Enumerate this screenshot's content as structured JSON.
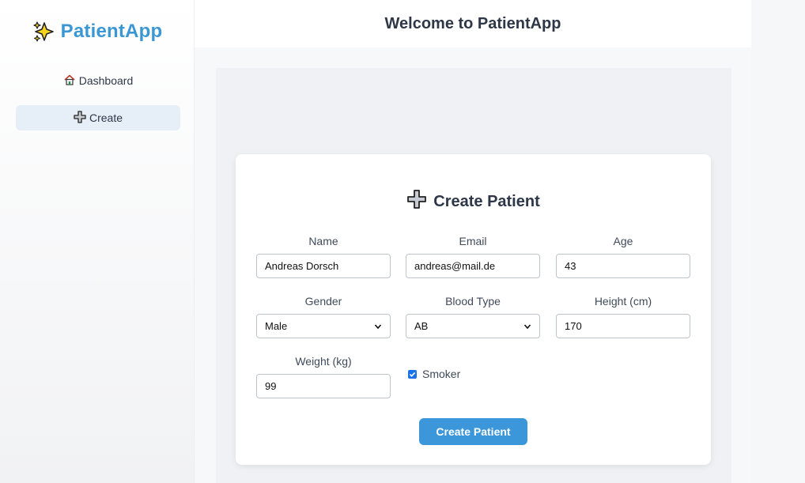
{
  "sidebar": {
    "brand": "PatientApp",
    "brand_icon": "sparkles-icon",
    "items": [
      {
        "label": "Dashboard",
        "icon": "house-icon",
        "active": false
      },
      {
        "label": "Create",
        "icon": "plus-icon",
        "active": true
      }
    ]
  },
  "header": {
    "title": "Welcome to PatientApp"
  },
  "form": {
    "title": "Create Patient",
    "title_icon": "plus-icon",
    "fields": {
      "name": {
        "label": "Name",
        "value": "Andreas Dorsch"
      },
      "email": {
        "label": "Email",
        "value": "andreas@mail.de"
      },
      "age": {
        "label": "Age",
        "value": "43"
      },
      "gender": {
        "label": "Gender",
        "value": "Male"
      },
      "blood_type": {
        "label": "Blood Type",
        "value": "AB"
      },
      "height": {
        "label": "Height (cm)",
        "value": "170"
      },
      "weight": {
        "label": "Weight (kg)",
        "value": "99"
      }
    },
    "smoker": {
      "label": "Smoker",
      "checked": true
    },
    "submit_label": "Create Patient"
  },
  "colors": {
    "accent": "#3b97d9",
    "brand": "#3b97d3",
    "active_nav": "#e6eef8"
  }
}
